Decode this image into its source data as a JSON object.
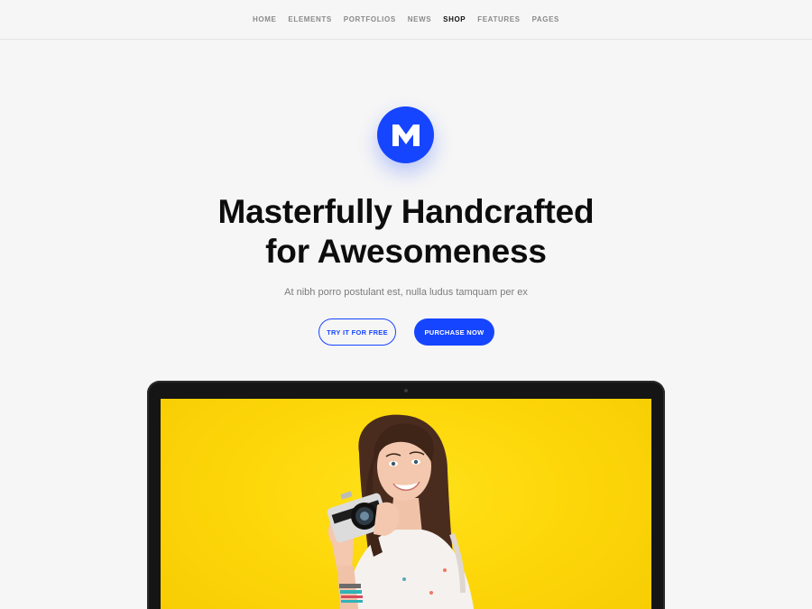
{
  "nav": {
    "items": [
      {
        "label": "HOME"
      },
      {
        "label": "ELEMENTS"
      },
      {
        "label": "PORTFOLIOS"
      },
      {
        "label": "NEWS"
      },
      {
        "label": "SHOP",
        "active": true
      },
      {
        "label": "FEATURES"
      },
      {
        "label": "PAGES"
      }
    ]
  },
  "hero": {
    "logo_letter": "M",
    "headline_line1": "Masterfully Handcrafted",
    "headline_line2": "for Awesomeness",
    "subtitle": "At nibh porro postulant est, nulla ludus tamquam per ex"
  },
  "buttons": {
    "try_label": "TRY IT FOR FREE",
    "purchase_label": "PURCHASE NOW"
  },
  "colors": {
    "accent": "#1645ff",
    "background": "#f6f6f6",
    "screen_yellow": "#fdd70a"
  },
  "icons": {
    "logo": "m-logo-icon",
    "camera": "camera-icon"
  }
}
